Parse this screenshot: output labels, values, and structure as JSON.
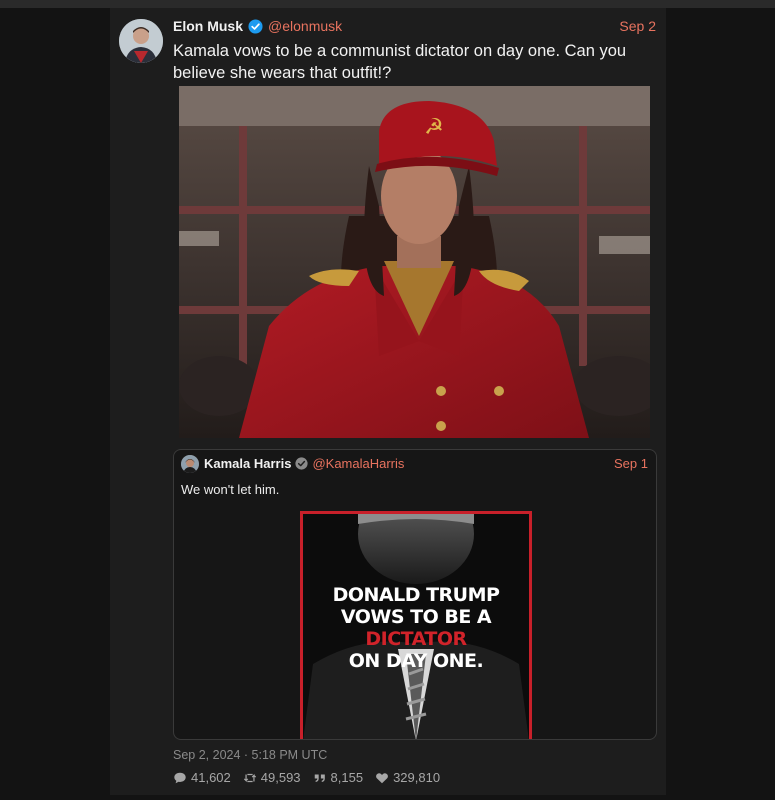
{
  "tweet": {
    "author_name": "Elon Musk",
    "handle": "@elonmusk",
    "date": "Sep 2",
    "text": "Kamala vows to be a communist dictator on day one. Can you believe she wears that outfit!?",
    "avatar_icon": "user-avatar-icon",
    "verified_color": "#1d9bf0",
    "accent_color": "#e8735f"
  },
  "quote": {
    "author_name": "Kamala Harris",
    "handle": "@KamalaHarris",
    "date": "Sep 1",
    "text": "We won't let him.",
    "poster": {
      "line1": "DONALD TRUMP",
      "line2": "VOWS TO BE A",
      "line3": "DICTATOR",
      "line4": "ON DAY ONE."
    }
  },
  "meta": {
    "timestamp": "Sep 2, 2024 · 5:18 PM UTC"
  },
  "stats": {
    "replies": "41,602",
    "retweets": "49,593",
    "quotes": "8,155",
    "likes": "329,810"
  }
}
